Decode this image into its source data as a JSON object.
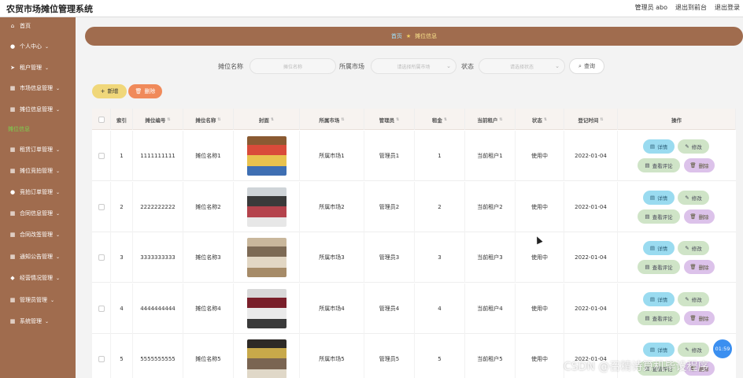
{
  "app": {
    "title": "农贸市场摊位管理系统"
  },
  "topbar": {
    "user": "管理员 abo",
    "to_front": "退出到前台",
    "logout": "退出登录"
  },
  "sidebar": {
    "items": [
      {
        "label": "首页",
        "icon": "home-icon",
        "chevron": false
      },
      {
        "label": "个人中心",
        "icon": "user-icon",
        "chevron": true
      },
      {
        "label": "租户管理",
        "icon": "send-icon",
        "chevron": true
      },
      {
        "label": "市场信息管理",
        "icon": "grid-icon",
        "chevron": true
      },
      {
        "label": "摊位信息管理",
        "icon": "grid-icon",
        "chevron": true
      },
      {
        "label": "摊位信息",
        "icon": "",
        "chevron": false,
        "active": true
      },
      {
        "label": "租赁订单管理",
        "icon": "grid-icon",
        "chevron": true
      },
      {
        "label": "摊位竞拍管理",
        "icon": "grid-icon",
        "chevron": true
      },
      {
        "label": "竞拍订单管理",
        "icon": "user-icon",
        "chevron": true
      },
      {
        "label": "合同信息管理",
        "icon": "grid-icon",
        "chevron": true
      },
      {
        "label": "合同改签管理",
        "icon": "grid-icon",
        "chevron": true
      },
      {
        "label": "通知公告管理",
        "icon": "grid-icon",
        "chevron": true
      },
      {
        "label": "经营情况管理",
        "icon": "pin-icon",
        "chevron": true
      },
      {
        "label": "管理员管理",
        "icon": "grid-icon",
        "chevron": true
      },
      {
        "label": "系统管理",
        "icon": "grid-icon",
        "chevron": true
      }
    ]
  },
  "breadcrumb": {
    "home": "首页",
    "current": "摊位信息"
  },
  "search": {
    "name_label": "摊位名称",
    "name_placeholder": "摊位名称",
    "market_label": "所属市场",
    "market_placeholder": "请选择所属市场",
    "status_label": "状态",
    "status_placeholder": "请选择状态",
    "query_label": "查询"
  },
  "actions": {
    "add_label": "新增",
    "delete_label": "删除"
  },
  "table": {
    "headers": [
      "索引",
      "摊位编号",
      "摊位名称",
      "封面",
      "所属市场",
      "管理员",
      "租金",
      "当前租户",
      "状态",
      "登记时间",
      "操作"
    ],
    "rows": [
      {
        "index": "1",
        "code": "1111111111",
        "name": "摊位名称1",
        "market": "所属市场1",
        "admin": "管理员1",
        "rent": "1",
        "tenant": "当前租户1",
        "status": "使用中",
        "date": "2022-01-04"
      },
      {
        "index": "2",
        "code": "2222222222",
        "name": "摊位名称2",
        "market": "所属市场2",
        "admin": "管理员2",
        "rent": "2",
        "tenant": "当前租户2",
        "status": "使用中",
        "date": "2022-01-04"
      },
      {
        "index": "3",
        "code": "3333333333",
        "name": "摊位名称3",
        "market": "所属市场3",
        "admin": "管理员3",
        "rent": "3",
        "tenant": "当前租户3",
        "status": "使用中",
        "date": "2022-01-04"
      },
      {
        "index": "4",
        "code": "4444444444",
        "name": "摊位名称4",
        "market": "所属市场4",
        "admin": "管理员4",
        "rent": "4",
        "tenant": "当前租户4",
        "status": "使用中",
        "date": "2022-01-04"
      },
      {
        "index": "5",
        "code": "5555555555",
        "name": "摊位名称5",
        "market": "所属市场5",
        "admin": "管理员5",
        "rent": "5",
        "tenant": "当前租户5",
        "status": "使用中",
        "date": "2022-01-04"
      }
    ],
    "ops": {
      "detail": "详情",
      "edit": "修改",
      "review": "查看评论",
      "remove": "删除"
    }
  },
  "overlay": {
    "timer": "01:59",
    "watermark": "CSDN @召精诗算机毕设程序"
  },
  "colors": {
    "sidebar": "#a06c4e",
    "accent_green": "#7bd14e",
    "add": "#f0d77a",
    "delete": "#f08a5a"
  }
}
